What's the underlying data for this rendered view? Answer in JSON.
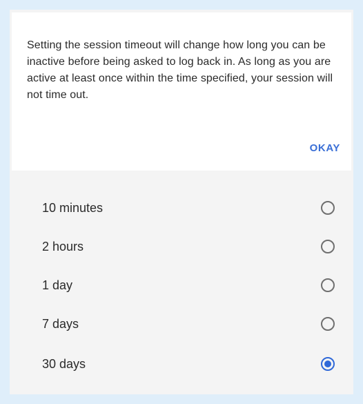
{
  "dialog": {
    "message": "Setting the session timeout will change how long you can be inactive before being asked to log back in. As long as you are active at least once within the time specified, your session will not time out.",
    "okay_label": "OKAY"
  },
  "timeout_options": [
    {
      "label": "10 minutes",
      "selected": false
    },
    {
      "label": "2 hours",
      "selected": false
    },
    {
      "label": "1 day",
      "selected": false
    },
    {
      "label": "7 days",
      "selected": false
    },
    {
      "label": "30 days",
      "selected": true
    }
  ],
  "colors": {
    "accent": "#2f68d8",
    "page_background": "#dfeefa",
    "card_background": "#ffffff",
    "options_background": "#f4f4f4"
  }
}
